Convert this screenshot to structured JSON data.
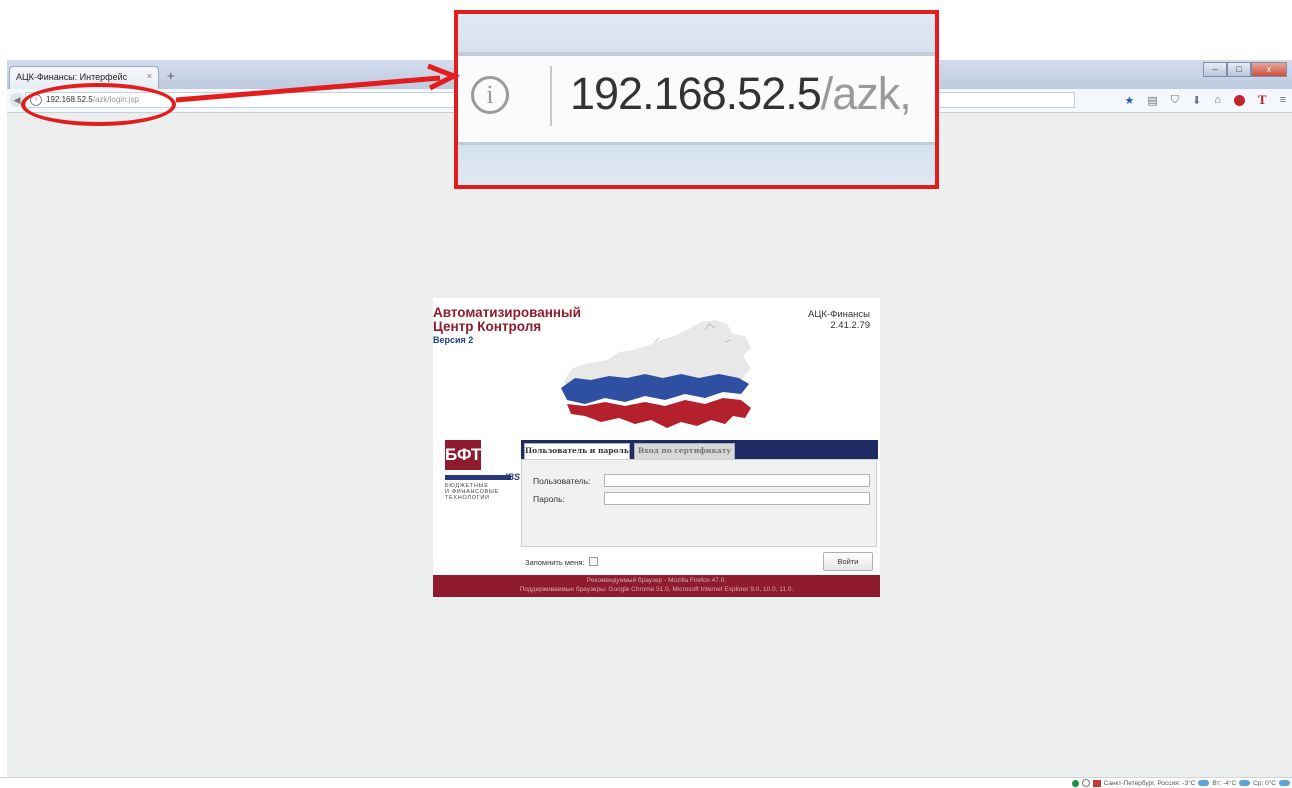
{
  "browser": {
    "tab_title": "АЦК-Финансы: Интерфейс",
    "tab_close": "×",
    "new_tab": "+",
    "url_host": "192.168.52.5",
    "url_path": "/azk/login.jsp",
    "window_controls": [
      "–",
      "□",
      "x"
    ],
    "toolbar_icons": [
      "bookmark-star-icon",
      "reading-list-icon",
      "pocket-icon",
      "download-icon",
      "home-icon",
      "adblock-icon",
      "translate-t-icon",
      "menu-icon"
    ]
  },
  "magnifier": {
    "url_host": "192.168.52.5",
    "url_path_partial": "/azk,"
  },
  "login": {
    "title_line1": "Автоматизированный",
    "title_line2": "Центр Контроля",
    "version": "Версия 2",
    "app_name": "АЦК-Финансы",
    "app_version": "2.41.2.79",
    "logo": {
      "brand": "БФТ",
      "ibs": "IBS",
      "caption": "БЮДЖЕТНЫЕ\nИ ФИНАНСОВЫЕ\nТЕХНОЛОГИИ"
    },
    "tabs": [
      "Пользователь и пароль",
      "Вход по сертификату"
    ],
    "fields": {
      "user_label": "Пользователь:",
      "user_value": "",
      "password_label": "Пароль:",
      "password_value": ""
    },
    "remember_label": "Запомнить меня:",
    "remember_checked": false,
    "login_button": "Войти",
    "footer_line1": "Рекомендуемый браузер - Mozilla Firefox 47.0.",
    "footer_line2": "Поддерживаемые браузеры: Google Chrome 51.0, Microsoft Internet Explorer 9.0, 10.0, 11.0."
  },
  "statusbar": {
    "weather": [
      "Санкт-Петербург, Россия: -3°C",
      "Вт: -4°C",
      "Ср: 0°C"
    ]
  },
  "colors": {
    "annotation_red": "#e31c1c",
    "brand_maroon": "#8f1b2e",
    "brand_navy": "#1e2c66"
  }
}
